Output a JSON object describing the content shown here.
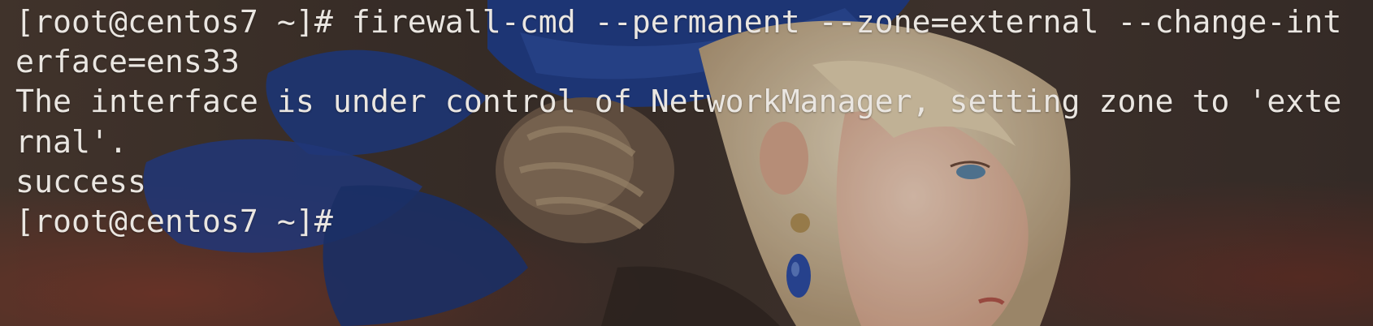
{
  "terminal": {
    "lines": [
      "[root@centos7 ~]# firewall-cmd --permanent --zone=external --change-int",
      "erface=ens33",
      "The interface is under control of NetworkManager, setting zone to 'exte",
      "rnal'.",
      "success",
      "[root@centos7 ~]#"
    ]
  },
  "colors": {
    "text": "#eae6e1",
    "background": "#3a302a",
    "ribbon": "#1f3d8a",
    "hair": "#d8c7a8",
    "skin": "#e9c3ab"
  }
}
